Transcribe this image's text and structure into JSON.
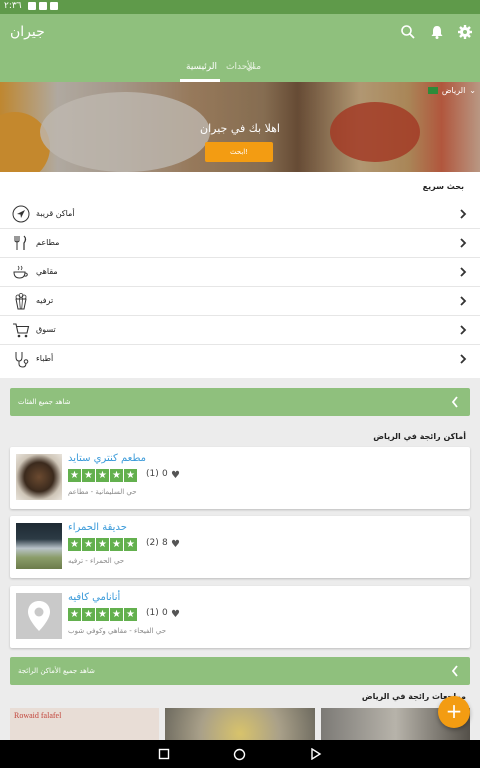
{
  "status": {
    "time": "٢:٣٦"
  },
  "appbar": {
    "title": "جيران"
  },
  "tabs": [
    {
      "label": "مني"
    },
    {
      "label": "الأحداث"
    },
    {
      "label": "الرئيسية"
    }
  ],
  "hero": {
    "city": "الرياض",
    "welcome": "اهلا بك في جيران",
    "cta": "ابحث!"
  },
  "quick_search": {
    "title": "بحث سريع",
    "items": [
      {
        "label": "أماكن قريبة",
        "icon": "navigation-arrow-icon"
      },
      {
        "label": "مطاعم",
        "icon": "fork-knife-icon"
      },
      {
        "label": "مقاهي",
        "icon": "coffee-cup-icon"
      },
      {
        "label": "ترفيه",
        "icon": "popcorn-icon"
      },
      {
        "label": "تسوق",
        "icon": "shopping-cart-icon"
      },
      {
        "label": "أطباء",
        "icon": "stethoscope-icon"
      }
    ]
  },
  "view_all_events": "شاهد جميع الفئات",
  "trending": {
    "title": "أماكن رائجة في الرياض",
    "places": [
      {
        "name": "مطعم كنتري ستايد",
        "rating_count": "(1)",
        "likes": "0",
        "meta": "حي السليمانية - مطاعم"
      },
      {
        "name": "حديقة الحمراء",
        "rating_count": "(2)",
        "likes": "8",
        "meta": "حي الحمراء - ترفيه"
      },
      {
        "name": "أنانامي كافيه",
        "rating_count": "(1)",
        "likes": "0",
        "meta": "حي الفيحاء - مقاهي وكوفي شوب"
      }
    ]
  },
  "view_all_trending": "شاهد جميع الأماكن الرائجة",
  "reviews_title": "مراجعات رائجة في الرياض",
  "photo_caption": "Rowaid falafel",
  "colors": {
    "primary": "#8fc07d",
    "status": "#5f9a4a",
    "accent": "#f39c12",
    "link": "#3a9ad9",
    "star": "#63b04e"
  }
}
